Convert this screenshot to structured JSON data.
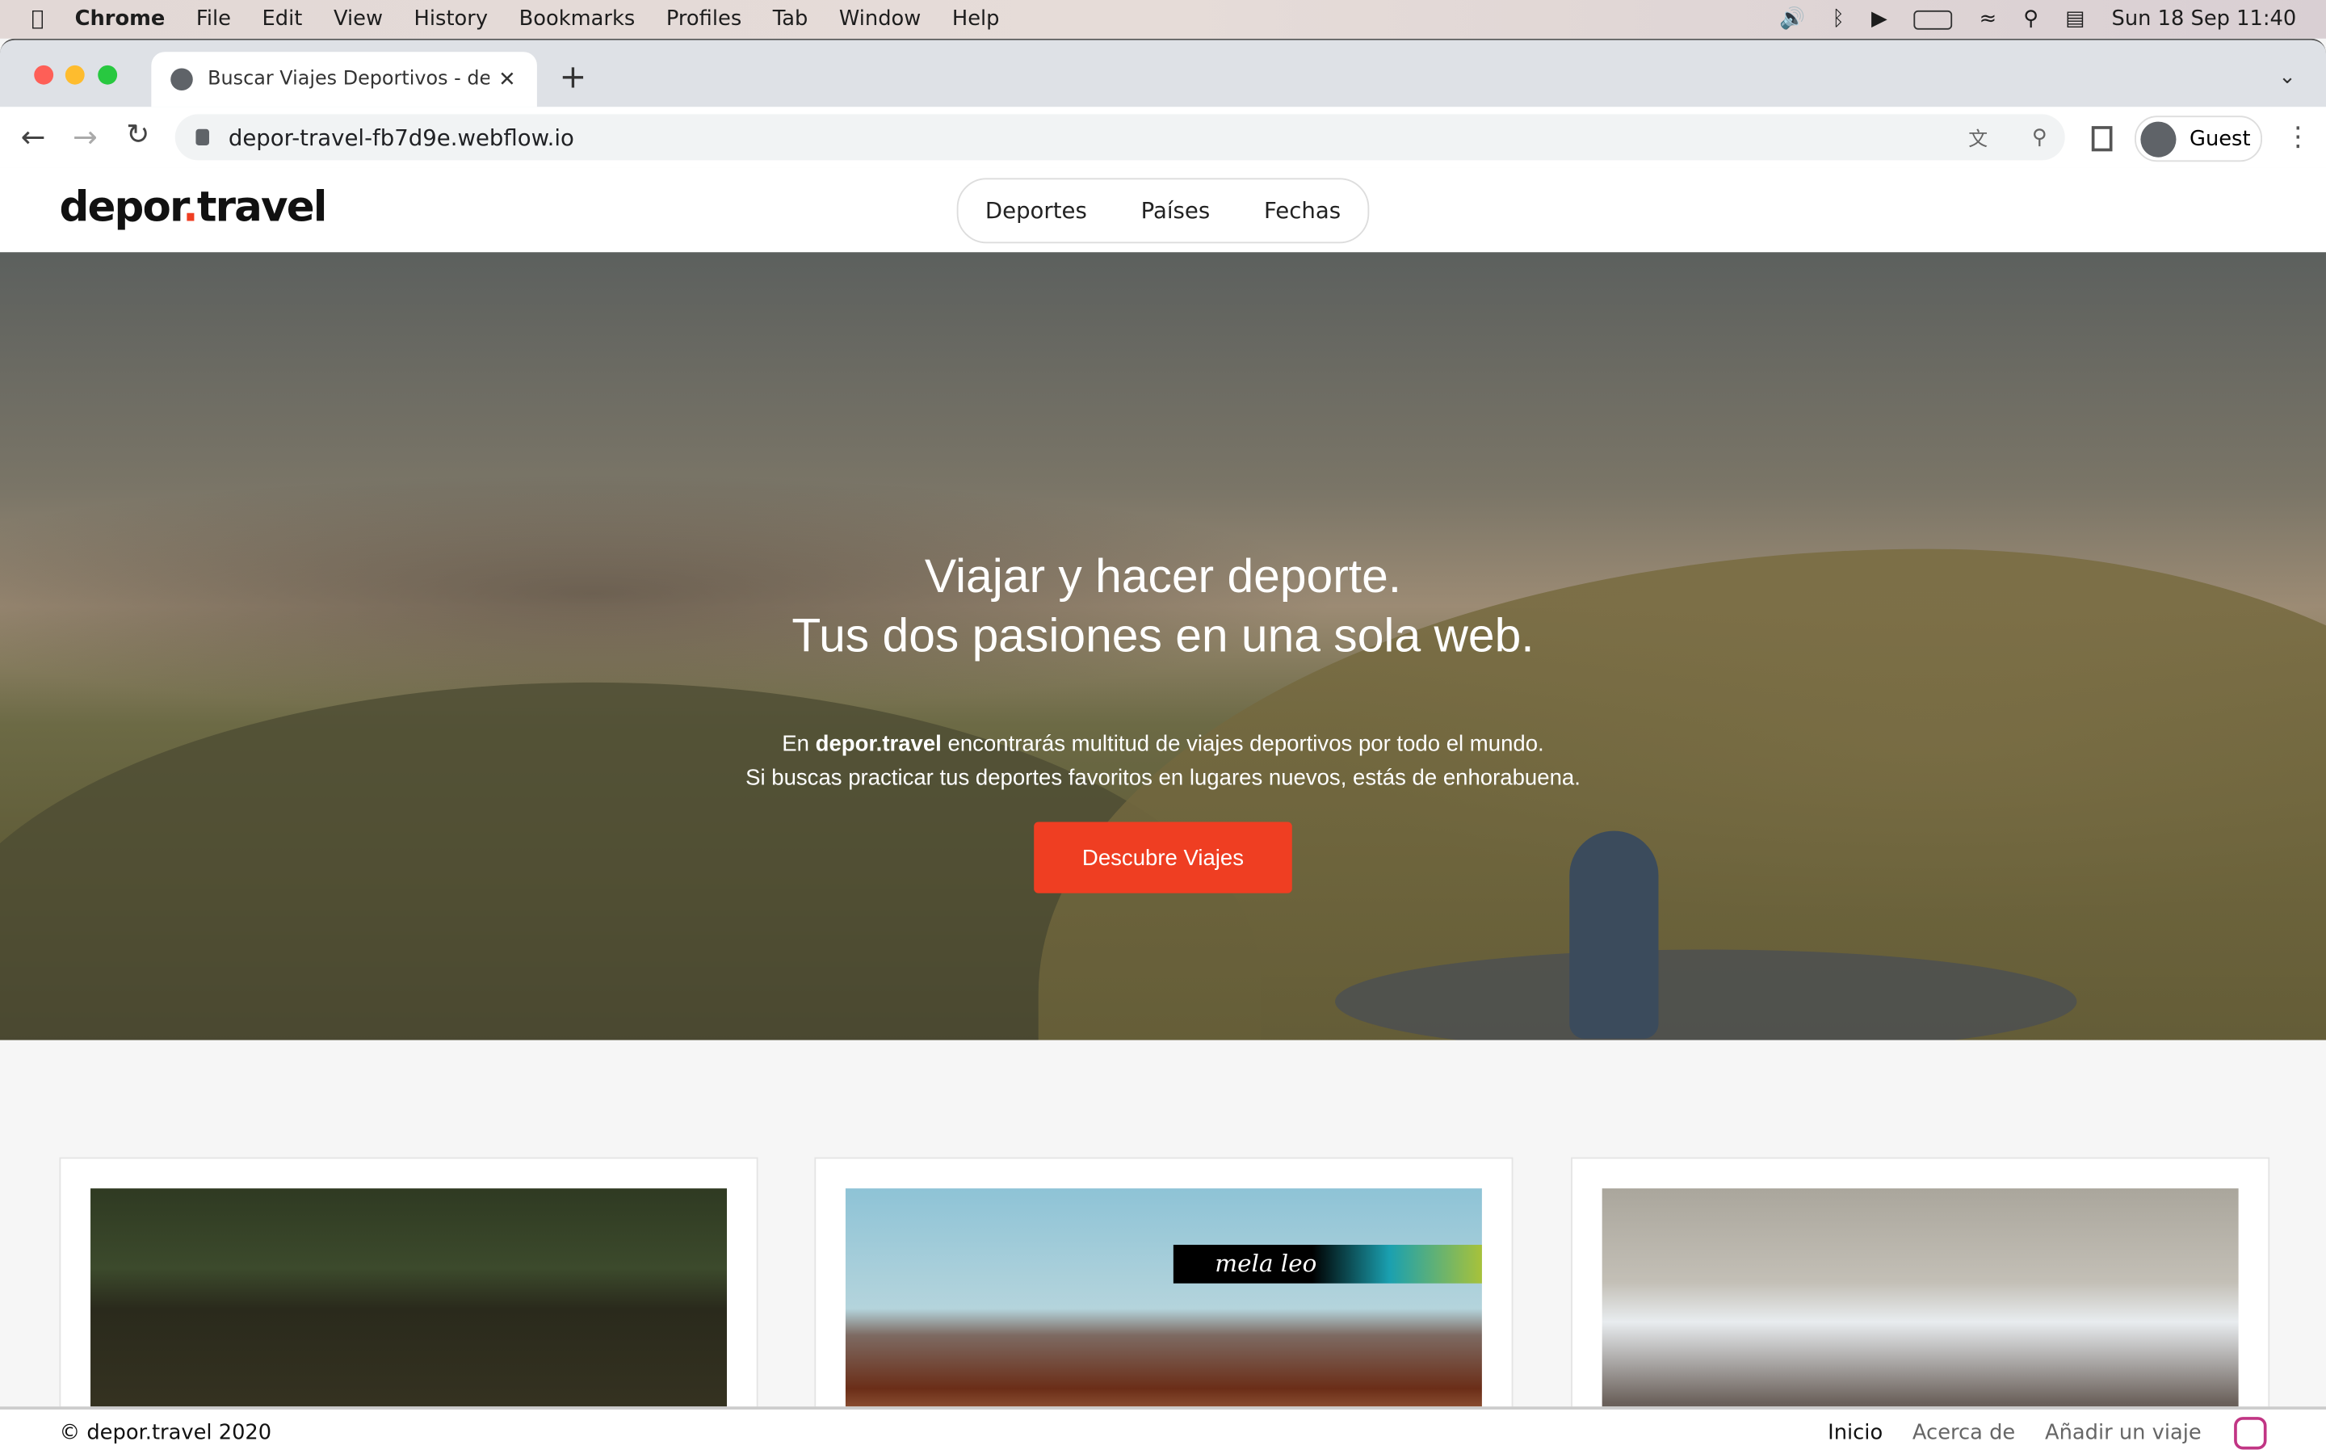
{
  "menubar": {
    "app": "Chrome",
    "items": [
      "File",
      "Edit",
      "View",
      "History",
      "Bookmarks",
      "Profiles",
      "Tab",
      "Window",
      "Help"
    ],
    "clock": "Sun 18 Sep  11:40"
  },
  "browser": {
    "tab_title": "Buscar Viajes Deportivos - dep",
    "url": "depor-travel-fb7d9e.webflow.io",
    "profile": "Guest"
  },
  "site": {
    "logo_a": "depor",
    "logo_dot": ".",
    "logo_b": "travel",
    "nav": [
      "Deportes",
      "Países",
      "Fechas"
    ]
  },
  "hero": {
    "title_1": "Viajar y hacer deporte.",
    "title_2": "Tus dos pasiones en una sola web.",
    "p1_pre": "En ",
    "p1_brand": "depor.travel",
    "p1_post": " encontrarás multitud de viajes deportivos por todo el mundo.",
    "p2": "Si buscas practicar tus deportes favoritos en lugares nuevos, estás de enhorabuena.",
    "cta": "Descubre Viajes"
  },
  "cards": [
    {
      "image": "lake-kayak"
    },
    {
      "image": "desert-mountains",
      "overlay": "mela leo"
    },
    {
      "image": "people-indoor"
    }
  ],
  "footer": {
    "copyright": "© depor.travel 2020",
    "links": [
      "Inicio",
      "Acerca de",
      "Añadir un viaje"
    ]
  },
  "colors": {
    "accent": "#ef3e22"
  }
}
